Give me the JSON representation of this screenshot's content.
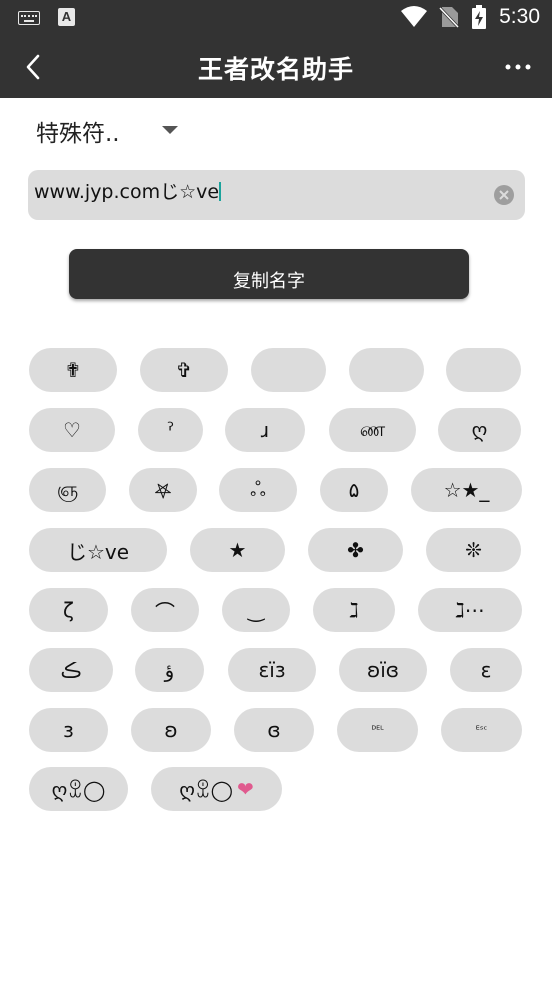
{
  "status_bar": {
    "time": "5:30",
    "icons": [
      "keyboard-icon",
      "a-letter-icon",
      "wifi-icon",
      "no-sim-icon",
      "battery-charging-icon"
    ]
  },
  "app_bar": {
    "title": "王者改名助手",
    "back_icon": "chevron-left-icon",
    "more_icon": "more-vertical-dots-icon"
  },
  "category": {
    "selected": "特殊符.."
  },
  "name_field": {
    "value": "www.jyp.comじ☆ve"
  },
  "copy_button": {
    "label": "复制名字"
  },
  "symbols": {
    "r1": [
      "✟",
      "✞",
      "",
      "",
      ""
    ],
    "r2": [
      "♡",
      "ˀ",
      "ɹ",
      "ண",
      "ღ"
    ],
    "r3": [
      "ஞ",
      "𖤐",
      "ஃ",
      "۵",
      "☆★_"
    ],
    "r4": [
      "じ☆ve",
      "★",
      "✤",
      "❊"
    ],
    "r5": [
      "ζ",
      "⌒",
      "‿",
      "ℷ",
      "ℷ⋯"
    ],
    "r6": [
      "ڪ",
      "ؤ",
      "ɛïɜ",
      "ʚïɞ",
      "ε"
    ],
    "r7": [
      "з",
      "ʚ",
      "ɞ",
      "ᴰᴱᴸ",
      "ᴱˢᶜ"
    ],
    "r8": [
      "ღꀾ◯",
      "ღꀾ◯",
      "❤"
    ]
  }
}
